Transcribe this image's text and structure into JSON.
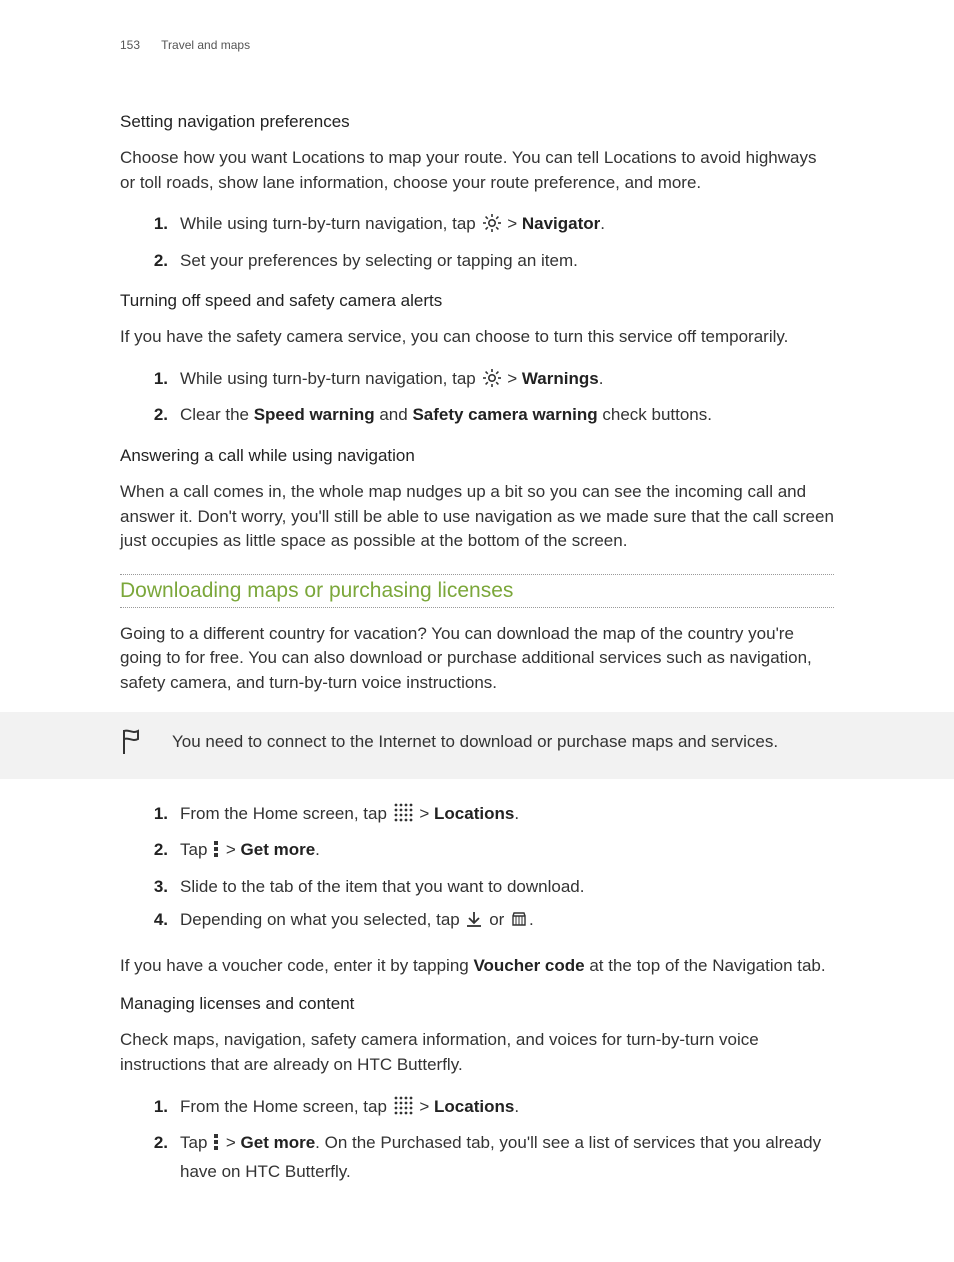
{
  "header": {
    "page": "153",
    "section": "Travel and maps"
  },
  "sec1": {
    "title": "Setting navigation preferences",
    "intro": "Choose how you want Locations to map your route. You can tell Locations to avoid highways or toll roads, show lane information, choose your route preference, and more.",
    "step1_a": "While using turn-by-turn navigation, tap ",
    "step1_b": " > ",
    "step1_bold": "Navigator",
    "step1_c": ".",
    "step2": "Set your preferences by selecting or tapping an item."
  },
  "sec2": {
    "title": "Turning off speed and safety camera alerts",
    "intro": "If you have the safety camera service, you can choose to turn this service off temporarily.",
    "step1_a": "While using turn-by-turn navigation, tap ",
    "step1_b": " > ",
    "step1_bold": "Warnings",
    "step1_c": ".",
    "step2_a": "Clear the ",
    "step2_bold1": "Speed warning",
    "step2_b": " and ",
    "step2_bold2": "Safety camera warning",
    "step2_c": " check buttons."
  },
  "sec3": {
    "title": "Answering a call while using navigation",
    "body": "When a call comes in, the whole map nudges up a bit so you can see the incoming call and answer it. Don't worry, you'll still be able to use navigation as we made sure that the call screen just occupies as little space as possible at the bottom of the screen."
  },
  "sec4": {
    "title": "Downloading maps or purchasing licenses",
    "intro": "Going to a different country for vacation? You can download the map of the country you're going to for free. You can also download or purchase additional services such as navigation, safety camera, and turn-by-turn voice instructions.",
    "note": "You need to connect to the Internet to download or purchase maps and services.",
    "step1_a": "From the Home screen, tap ",
    "step1_b": " > ",
    "step1_bold": "Locations",
    "step1_c": ".",
    "step2_a": "Tap ",
    "step2_b": " > ",
    "step2_bold": "Get more",
    "step2_c": ".",
    "step3": "Slide to the tab of the item that you want to download.",
    "step4_a": "Depending on what you selected, tap ",
    "step4_b": " or ",
    "step4_c": ".",
    "voucher_a": "If you have a voucher code, enter it by tapping ",
    "voucher_bold": "Voucher code",
    "voucher_b": " at the top of the Navigation tab."
  },
  "sec5": {
    "title": "Managing licenses and content",
    "intro": "Check maps, navigation, safety camera information, and voices for turn-by-turn voice instructions that are already on HTC Butterfly.",
    "step1_a": "From the Home screen, tap ",
    "step1_b": " > ",
    "step1_bold": "Locations",
    "step1_c": ".",
    "step2_a": "Tap ",
    "step2_b": " > ",
    "step2_bold": "Get more",
    "step2_c": ". On the Purchased tab, you'll see a list of services that you already have on HTC Butterfly."
  }
}
